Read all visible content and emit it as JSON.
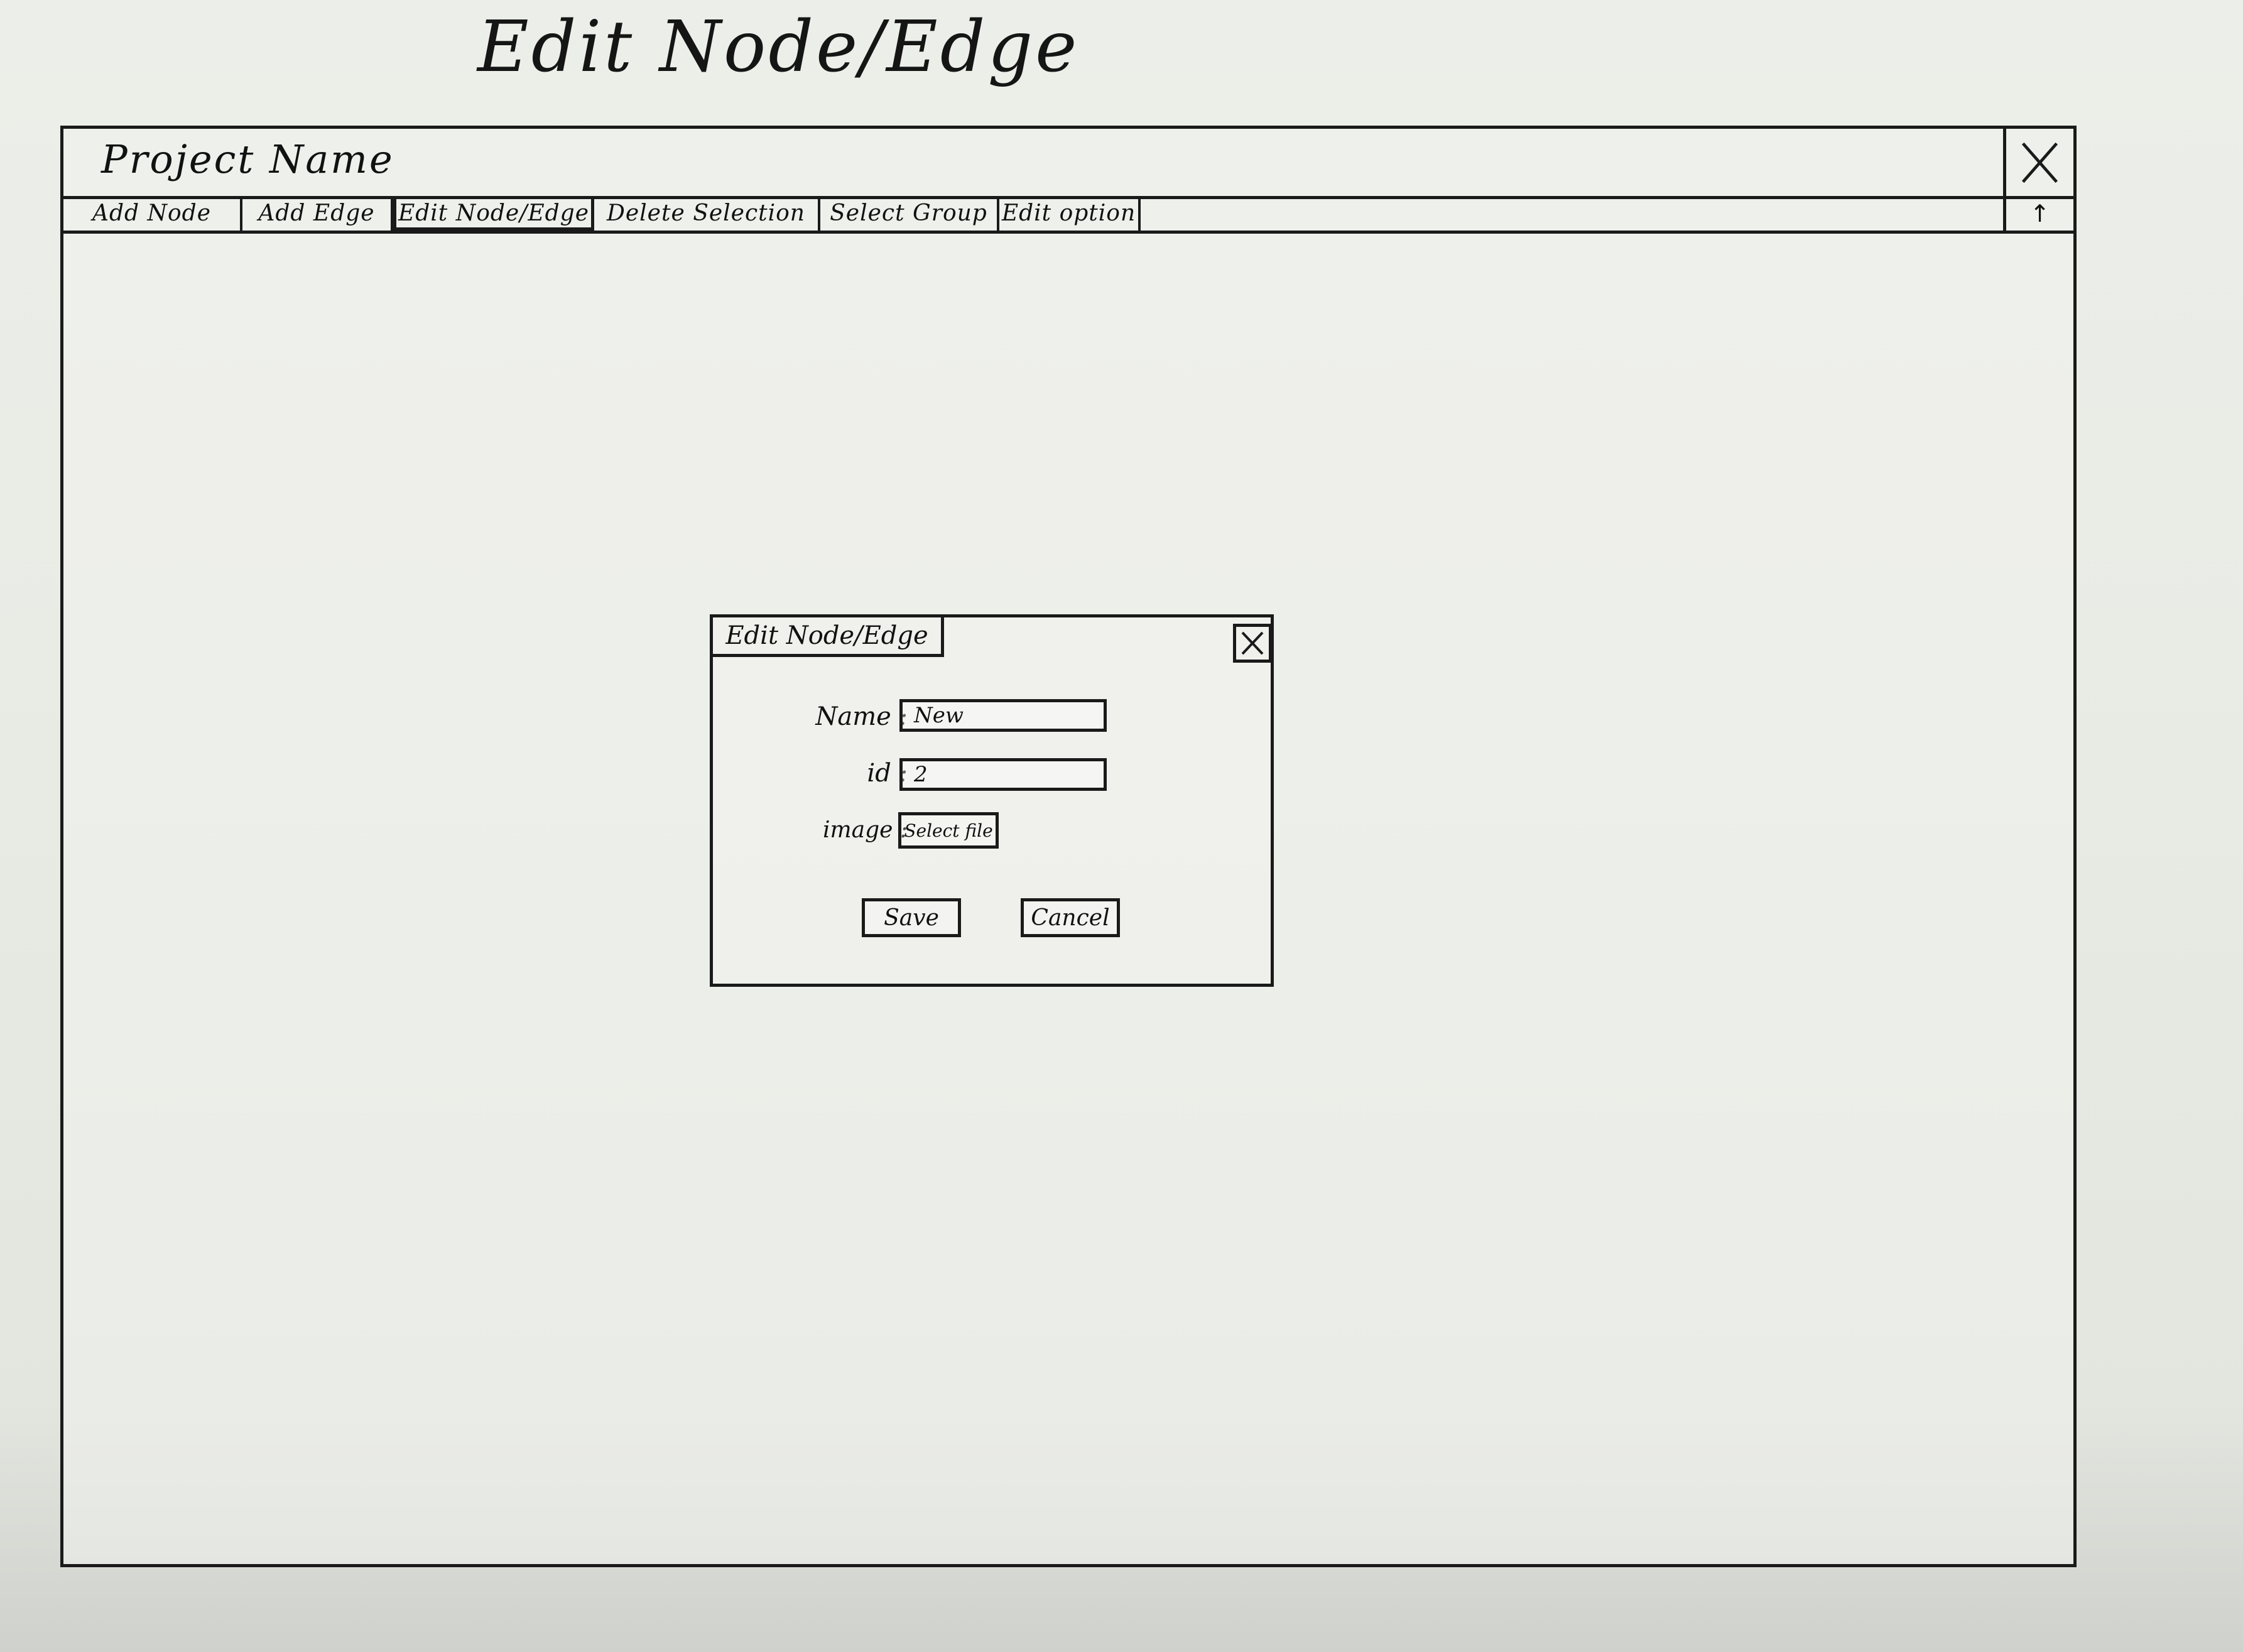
{
  "sheet_title": "Edit Node/Edge",
  "window": {
    "title": "Project Name",
    "close_icon": "close-icon",
    "toolbar": {
      "tabs": [
        {
          "label": "Add Node"
        },
        {
          "label": "Add Edge"
        },
        {
          "label": "Edit Node/Edge"
        },
        {
          "label": "Delete Selection"
        },
        {
          "label": "Select Group"
        },
        {
          "label": "Edit option"
        }
      ],
      "active_tab": "Edit Node/Edge",
      "collapse_icon": "up-arrow-icon",
      "collapse_glyph": "↑"
    }
  },
  "dialog": {
    "title": "Edit Node/Edge",
    "close_icon": "close-icon",
    "name_label": "Name :",
    "name_value": "New",
    "id_label": "id :",
    "id_value": "2",
    "image_label": "image :",
    "select_file_label": "Select file",
    "save_label": "Save",
    "cancel_label": "Cancel"
  }
}
